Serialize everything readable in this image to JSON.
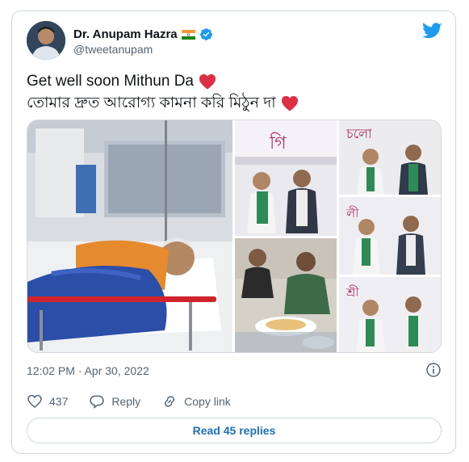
{
  "author": {
    "name": "Dr. Anupam Hazra",
    "handle": "@tweetanupam",
    "flag_icon": "india-flag-icon",
    "verified_icon": "verified-badge-icon"
  },
  "tweet": {
    "line1": "Get well soon Mithun Da",
    "line2": "তোমার দ্রুত আরোগ্য কামনা করি মিঠুন দা",
    "emoji_icon": "red-heart-icon"
  },
  "meta": {
    "timestamp": "12:02 PM · Apr 30, 2022"
  },
  "actions": {
    "likes": "437",
    "reply_label": "Reply",
    "copy_label": "Copy link"
  },
  "read_replies_label": "Read 45 replies",
  "colors": {
    "twitter_blue": "#1d9bf0",
    "link_blue": "#1d6fb8",
    "border": "#cfd9de",
    "secondary_text": "#536471",
    "heart_red": "#e0245e"
  }
}
